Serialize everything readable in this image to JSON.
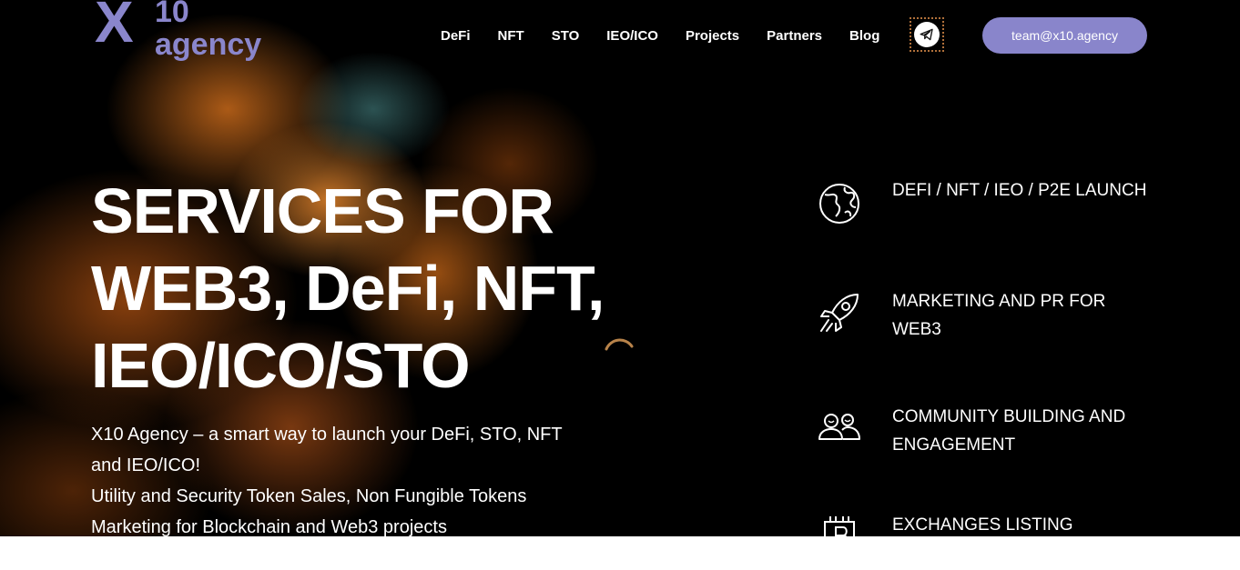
{
  "logo": {
    "x": "X",
    "ten": "10",
    "agency": "agency"
  },
  "nav": {
    "items": [
      "DeFi",
      "NFT",
      "STO",
      "IEO/ICO",
      "Projects",
      "Partners",
      "Blog"
    ]
  },
  "header": {
    "cta_email": "team@x10.agency"
  },
  "hero": {
    "headline_lines": [
      "SERVICES FOR",
      "WEB3, DeFi, NFT,",
      "IEO/ICO/STO"
    ],
    "description_lines": [
      "X10 Agency – a smart way to launch your DeFi, STO, NFT",
      "and IEO/ICO!",
      "Utility and Security Token Sales, Non Fungible Tokens",
      "Marketing for Blockchain and Web3 projects"
    ]
  },
  "services": [
    {
      "icon": "globe-icon",
      "label": "DEFI / NFT / IEO / P2E LAUNCH"
    },
    {
      "icon": "rocket-icon",
      "label": "MARKETING AND PR FOR WEB3"
    },
    {
      "icon": "community-icon",
      "label": "COMMUNITY BUILDING AND ENGAGEMENT"
    },
    {
      "icon": "bitcoin-chip-icon",
      "label": "EXCHANGES LISTING"
    }
  ],
  "colors": {
    "accent": "#8985cb",
    "logo": "#8a86cc",
    "background": "#000000",
    "text": "#ffffff"
  }
}
